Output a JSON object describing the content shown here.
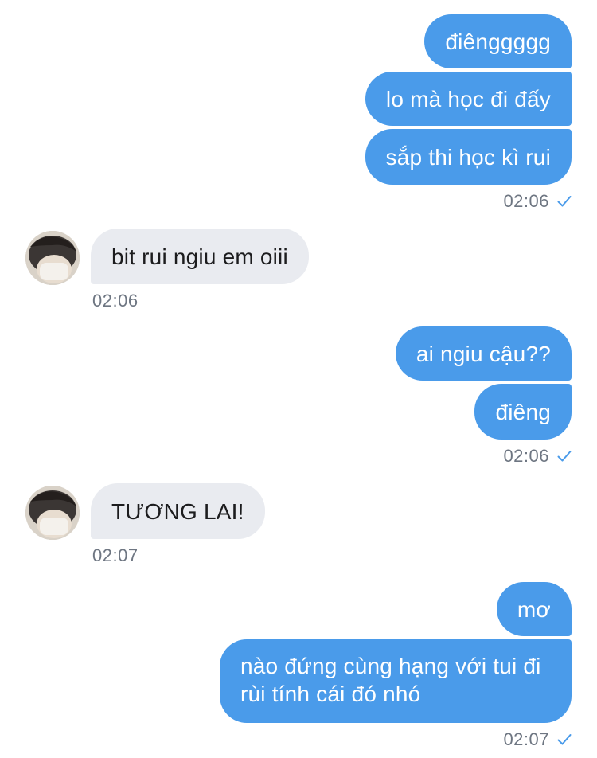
{
  "messages": {
    "m1": "điênggggg",
    "m2": "lo mà học đi đấy",
    "m3": "sắp thi học kì rui",
    "m4": "bit rui ngiu em oiii",
    "m5": "ai ngiu cậu??",
    "m6": "điêng",
    "m7": "TƯƠNG LAI!",
    "m8": "mơ",
    "m9": "nào đứng cùng hạng với tui đi rùi tính cái đó nhó"
  },
  "times": {
    "t1": "02:06",
    "t2": "02:06",
    "t3": "02:06",
    "t4": "02:07",
    "t5": "02:07"
  },
  "colors": {
    "outgoing_bubble": "#4a9bea",
    "incoming_bubble": "#e9ebf0",
    "read_check": "#4a9bea",
    "timestamp": "#6e7682"
  },
  "icons": {
    "read_receipt": "checkmark-icon",
    "contact_avatar": "avatar"
  }
}
